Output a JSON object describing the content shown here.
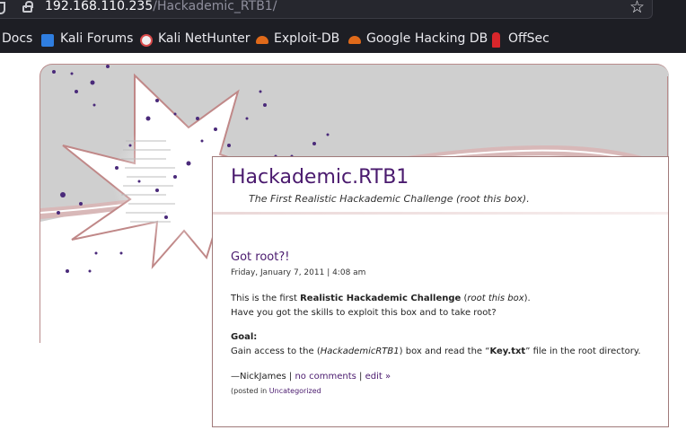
{
  "browser": {
    "url_host": "192.168.110.235",
    "url_path": "/Hackademic_RTB1/",
    "bookmarks": [
      {
        "label": "Docs",
        "icon": "docs-icon"
      },
      {
        "label": "Kali Forums",
        "icon": "kali-forums-icon",
        "color": "#3a7bd5"
      },
      {
        "label": "Kali NetHunter",
        "icon": "nethunter-icon",
        "color": "#d84a4a"
      },
      {
        "label": "Exploit-DB",
        "icon": "exploit-db-icon",
        "color": "#e06a1a"
      },
      {
        "label": "Google Hacking DB",
        "icon": "ghdb-icon",
        "color": "#e06a1a"
      },
      {
        "label": "OffSec",
        "icon": "offsec-icon",
        "color": "#d8262b"
      }
    ]
  },
  "site": {
    "title": "Hackademic.RTB1",
    "description": "The First Realistic Hackademic Challenge (root this box).",
    "accent": "#4a1a6e"
  },
  "post": {
    "title": "Got root?!",
    "date": "Friday, January 7, 2011 | 4:08 am",
    "p1_a": "This is the first ",
    "p1_b": "Realistic Hackademic Challenge",
    "p1_c": " (",
    "p1_d": "root this box",
    "p1_e": ").",
    "p2": "Have you got the skills to exploit this box and to take root?",
    "goal_label": "Goal:",
    "goal_a": "Gain access to the (",
    "goal_b": "HackademicRTB1",
    "goal_c": ") box and read the “",
    "goal_d": "Key.txt",
    "goal_e": "” file in the root directory.",
    "author": "—NickJames",
    "sep1": " | ",
    "comments": "no comments",
    "sep2": " | ",
    "edit": "edit »",
    "posted_in": "(posted in ",
    "category": "Uncategorized"
  }
}
